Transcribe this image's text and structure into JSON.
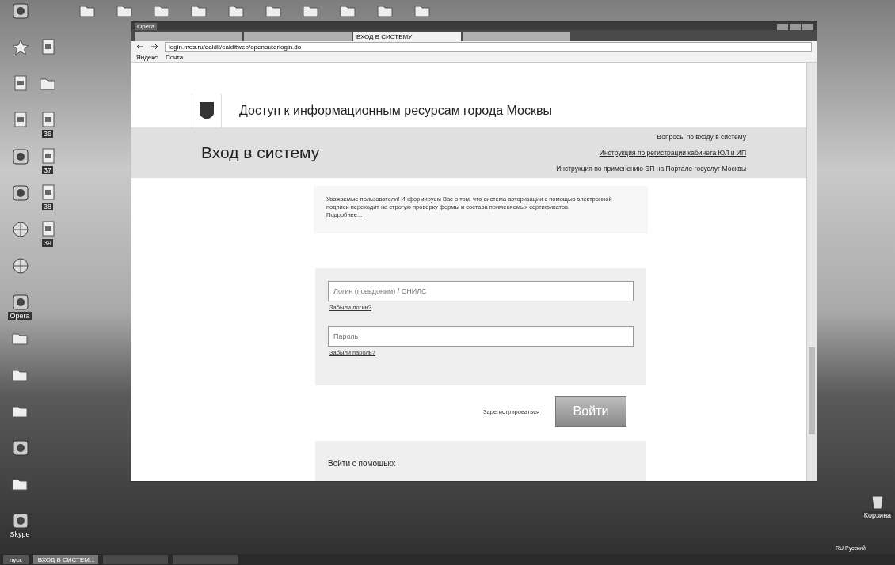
{
  "desktop": {
    "top_icons": [
      {
        "kind": "folder"
      },
      {
        "kind": "folder"
      },
      {
        "kind": "folder"
      },
      {
        "kind": "folder"
      },
      {
        "kind": "folder"
      },
      {
        "kind": "folder"
      },
      {
        "kind": "folder"
      },
      {
        "kind": "folder"
      },
      {
        "kind": "folder"
      },
      {
        "kind": "folder"
      }
    ],
    "column_1": [
      {
        "kind": "app"
      },
      {
        "kind": "star"
      },
      {
        "kind": "doc"
      },
      {
        "kind": "doc"
      },
      {
        "kind": "app"
      },
      {
        "kind": "app"
      },
      {
        "kind": "globe"
      },
      {
        "kind": "globe"
      },
      {
        "kind": "app",
        "label": "Opera"
      },
      {
        "kind": "folder"
      },
      {
        "kind": "folder"
      },
      {
        "kind": "folder"
      },
      {
        "kind": "app"
      },
      {
        "kind": "folder"
      },
      {
        "kind": "app",
        "label": "Skype"
      }
    ],
    "column_2": [
      {
        "kind": "doc"
      },
      {
        "kind": "folder"
      },
      {
        "kind": "doc",
        "label": "36"
      },
      {
        "kind": "doc",
        "label": "37"
      },
      {
        "kind": "doc",
        "label": "38"
      },
      {
        "kind": "doc",
        "label": "39"
      }
    ],
    "recycle_bin": {
      "label": "Корзина"
    }
  },
  "browser": {
    "window_title": "Opera",
    "tabs": [
      {
        "selected": false
      },
      {
        "selected": false
      },
      {
        "title": "ВХОД В СИСТЕМУ",
        "selected": true
      },
      {
        "selected": false
      }
    ],
    "address": "login.mos.ru/eaidit/eaiditweb/openouterlogin.do",
    "bookmarks": [
      "Яндекс",
      "Почта"
    ]
  },
  "page": {
    "header_title": "Доступ к информационным ресурсам города Москвы",
    "login_title": "Вход в систему",
    "help_links": [
      {
        "text": "Вопросы по входу в систему",
        "underlined": false
      },
      {
        "text": "Инструкция по регистрации кабинета ЮЛ и ИП",
        "underlined": true
      },
      {
        "text": "Инструкция по применению ЭП на Портале госуслуг Москвы",
        "underlined": false
      }
    ],
    "notice": {
      "text": "Уважаемые пользователи! Информируем Вас о том, что система авторизации с помощью электронной подписи переходит на строгую проверку формы и состава применяемых сертификатов.",
      "link": "Подробнее..."
    },
    "fields": [
      {
        "placeholder": "Логин (псевдоним) / СНИЛС",
        "link": "Забыли логин?"
      },
      {
        "placeholder": "Пароль",
        "link": "Забыли пароль?"
      }
    ],
    "register_link": "Зарегистрироваться",
    "submit_button": "Войти",
    "alt_login": "Войти с помощью:"
  },
  "taskbar": {
    "start": "пуск",
    "items": [
      {
        "title": "ВХОД В СИСТЕМ...",
        "selected": true
      },
      {
        "selected": false
      },
      {
        "selected": false
      }
    ],
    "language": "RU Русский"
  }
}
